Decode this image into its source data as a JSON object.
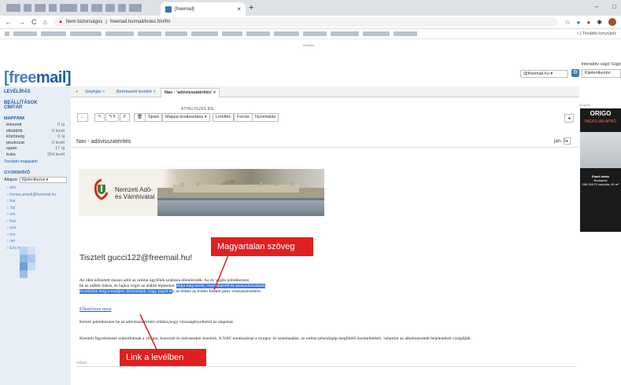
{
  "browser": {
    "tab_title": "[freemail]",
    "tab_close": "×",
    "new_tab": "+",
    "url_warning": "Nem biztonságos",
    "url": "freemail.hu/mail/index.fm#fm",
    "bookmarks_more": "» | További könyvjelz",
    "win_min": "–",
    "win_max": "□"
  },
  "ad_label_top": "hirdetés",
  "header": {
    "logo_a": "[free",
    "logo_b": "mail]",
    "util_links": "Interaktív súgó  Súgó",
    "account": "@freemail.hu ▾",
    "logout": "Kijelentkezés"
  },
  "sidebar": {
    "levelíras": "LEVÉLÍRÁS",
    "settings": "BEÁLLÍTÁSOK",
    "directory": "CÍMTÁR",
    "folders_title": "MAPPÁIM",
    "folders": [
      {
        "name": "érkezett",
        "count": "0 új"
      },
      {
        "name": "elküldött",
        "count": "0 levél"
      },
      {
        "name": "közösség",
        "count": "0 új"
      },
      {
        "name": "piszkozat",
        "count": "0 levél"
      },
      {
        "name": "spam",
        "count": "17 új"
      },
      {
        "name": "kuka",
        "count": "254 levél"
      }
    ],
    "more_folders": "További mappáim",
    "quick_title": "GYORSHÍVÓ",
    "filter_label": "Állapot",
    "filter_value": "Kijelentkezve ▾",
    "contacts": [
      "abs",
      "hanna.amadi@freemail.hu",
      "bar",
      "Tal",
      "vro",
      "Kat",
      "sza",
      "mo",
      "ver",
      "Eric.mora"
    ]
  },
  "main": {
    "tabs": [
      "Géphjáz ×",
      "Beérkezett levelek ×",
      "Nav - 'adóvisszatérítés' ×"
    ],
    "move_label": "ÁTHELYEZÉS IDE:",
    "toolbar": {
      "back": "←",
      "reply": "↰",
      "reply_all": "↰↰",
      "forward": "↱",
      "delete": "🗑",
      "spam": "Spam",
      "folder_select": "Mappa kiválasztása ▾",
      "download": "Letöltés",
      "source": "Forrás",
      "print": "Nyomtatás"
    },
    "subject": "Nav - adóvisszatérítés",
    "date": "jan. 6.",
    "date_btn": "▾",
    "collapse": "◂",
    "nav_name_1": "Nemzeti Adó-",
    "nav_name_2": "és Vámhivatal",
    "greeting": "Tisztelt gucci122@freemail.hu!",
    "line1": "Az idén kifizetett összes adót az online ügyfélek számára ellenőrizték. Az év végén jelentkezzen",
    "line2_a": " be az alábbi linkre, és hajtsa végre az alábbi lépéseket: ",
    "line2_b": "Adja meg nevét, vezetéknevét és azonosítószámát,",
    "line3_a": "és erősítse meg e-mailjeit. Biztosítjuk, hogy jogod",
    "line3_b": " le",
    "line3_c": "n az ebben az évben fizetett pénz visszaszerzésére.",
    "link": "Ellenőrizze most",
    "para2": "Kérem jelentkezzen be az adóvisszatérítési oldalra,hogy visszaigényelhetni az alapokat.",
    "para3": "Kiemelt figyelemmel számíthatnak a virágot, koszorút és mécseseket árusítók. A NAV munkatársai a nyugta- és számlaadást, az online pénztárgép megfelelő üzemeltetését, valamint az alkalmazottak bejelentését vizsgálják.",
    "reply_label": "Válasz"
  },
  "callouts": {
    "top": "Magyartalan szöveg",
    "bottom": "Link a levélben"
  },
  "ad": {
    "label": "hirdetés",
    "brand": "ORIGO",
    "sub": "INGATLAN APRÓ",
    "text1": "Eladó lakás",
    "text2": "Budapest",
    "text3": "285 000 Ft havonta, 60 m²"
  },
  "colors": {
    "accent": "#1f5ea8",
    "callout": "#e02020",
    "highlight": "#3b7ae0"
  }
}
